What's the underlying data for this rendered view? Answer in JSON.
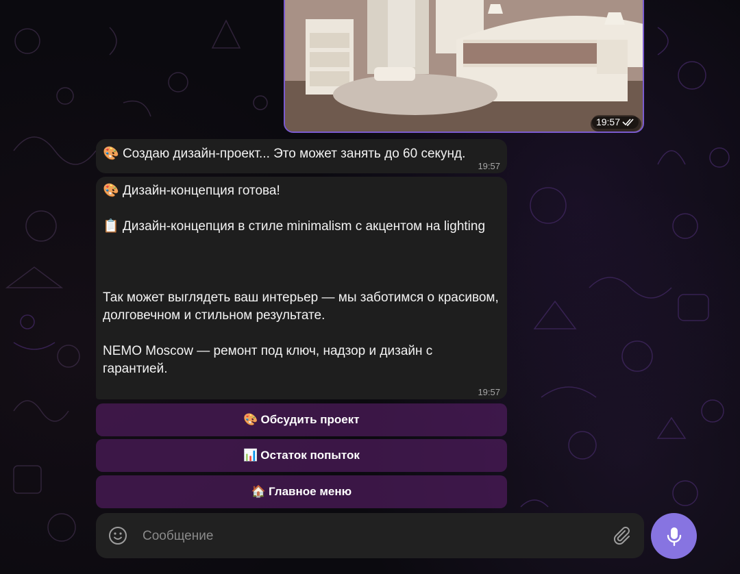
{
  "photo_message": {
    "time": "19:57",
    "status_icon": "double-check-icon"
  },
  "messages": [
    {
      "emoji": "🎨",
      "text": "Создаю дизайн-проект... Это может занять до 60 секунд.",
      "time": "19:57"
    },
    {
      "lines": [
        "🎨 Дизайн-концепция готова!",
        "",
        "📋 Дизайн-концепция в стиле minimalism с акцентом на lighting",
        "",
        "",
        "",
        "Так может выглядеть ваш интерьер — мы заботимся о красивом, долговечном и стильном результате.",
        "",
        "NEMO Moscow — ремонт под ключ, надзор и дизайн с гарантией."
      ],
      "time": "19:57"
    }
  ],
  "keyboard": [
    {
      "emoji": "🎨",
      "label": "Обсудить проект"
    },
    {
      "emoji": "📊",
      "label": "Остаток попыток"
    },
    {
      "emoji": "🏠",
      "label": "Главное меню"
    }
  ],
  "composer": {
    "placeholder": "Сообщение",
    "value": ""
  },
  "colors": {
    "accent": "#8774e1",
    "bubble": "#1e1e1e",
    "keyboard_button": "#4e1c5c"
  }
}
